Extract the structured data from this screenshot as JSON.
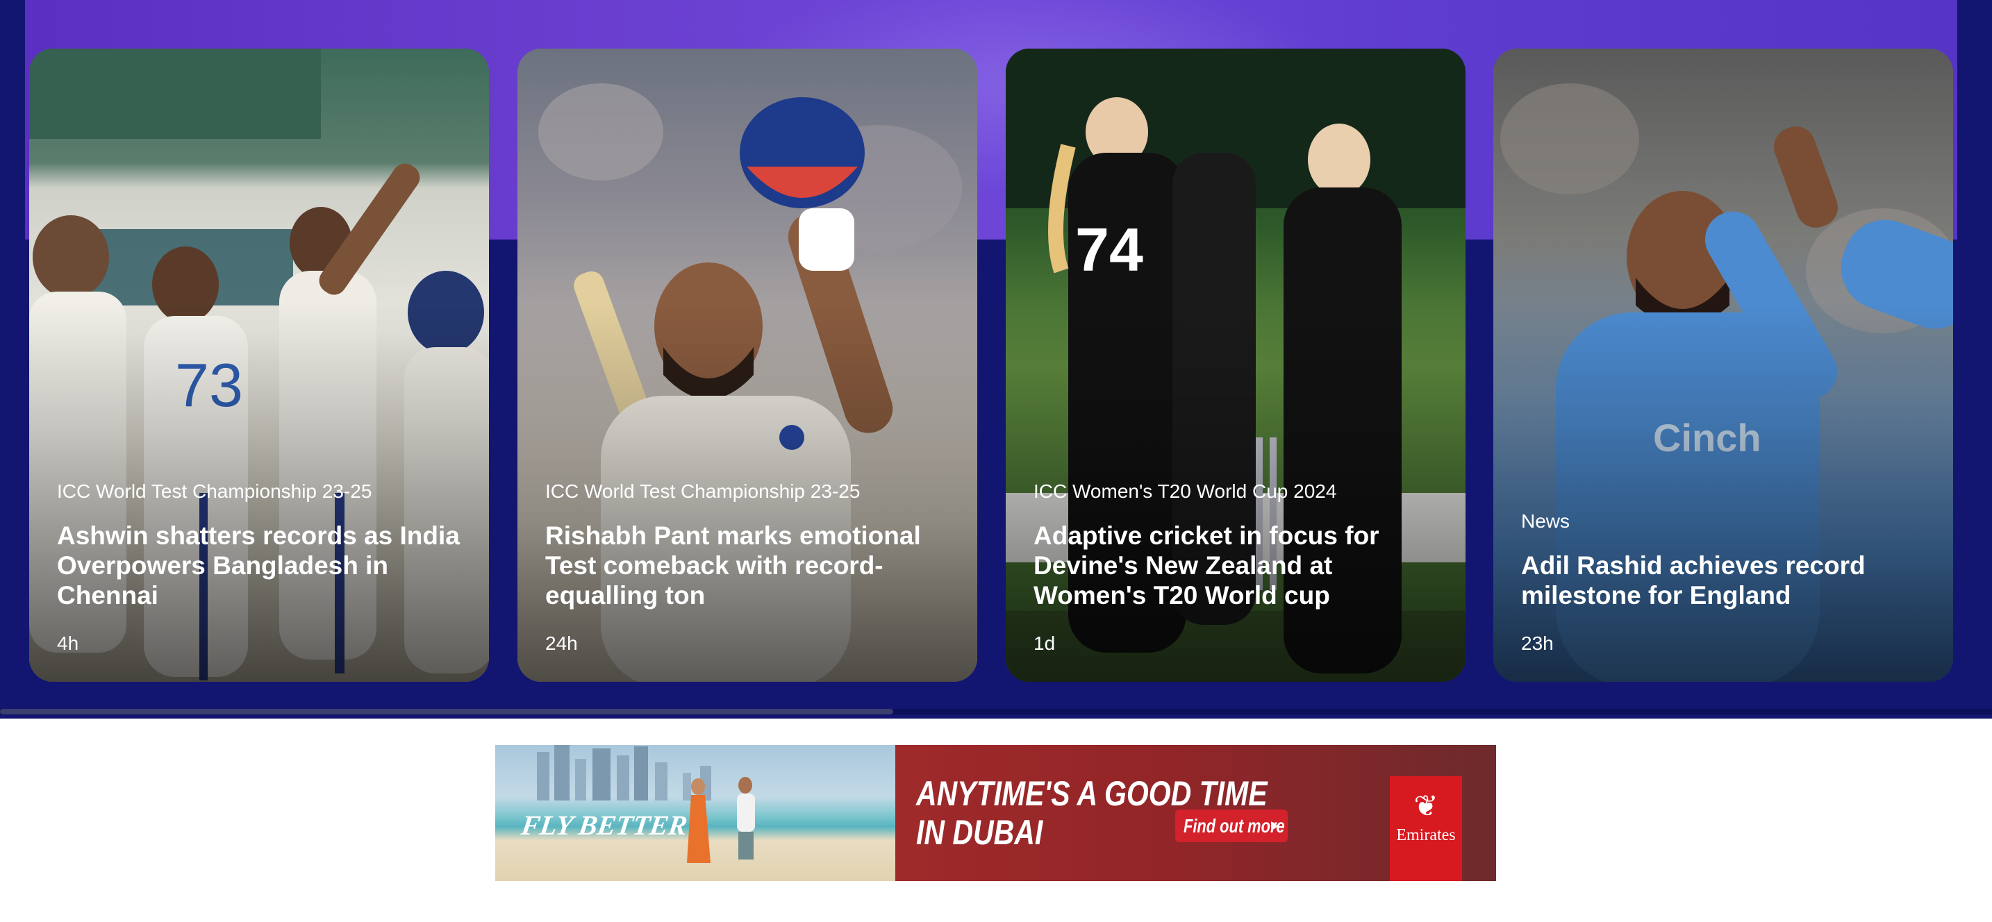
{
  "cards": [
    {
      "category": "ICC World Test Championship 23-25",
      "headline": "Ashwin shatters records as India Overpowers Bangladesh in Chennai",
      "time": "4h"
    },
    {
      "category": "ICC World Test Championship 23-25",
      "headline": "Rishabh Pant marks emotional Test comeback with record-equalling ton",
      "time": "24h"
    },
    {
      "category": "ICC Women's T20 World Cup 2024",
      "headline": "Adaptive cricket in focus for Devine's New Zealand at Women's T20 World cup",
      "time": "1d"
    },
    {
      "category": "News",
      "headline": "Adil Rashid achieves record milestone for England",
      "time": "23h"
    }
  ],
  "carousel": {
    "scroll_position_fraction": 0.45
  },
  "ad": {
    "tagline": "FLY BETTER",
    "headline": "ANYTIME'S A GOOD TIME\nIN DUBAI",
    "cta": "Find out more",
    "brand": "Emirates",
    "colors": {
      "brand_red": "#d71920",
      "panel_red": "#9f2a2a"
    }
  },
  "colors": {
    "hero_navy": "#121670",
    "hero_purple": "#6a3fd0"
  }
}
